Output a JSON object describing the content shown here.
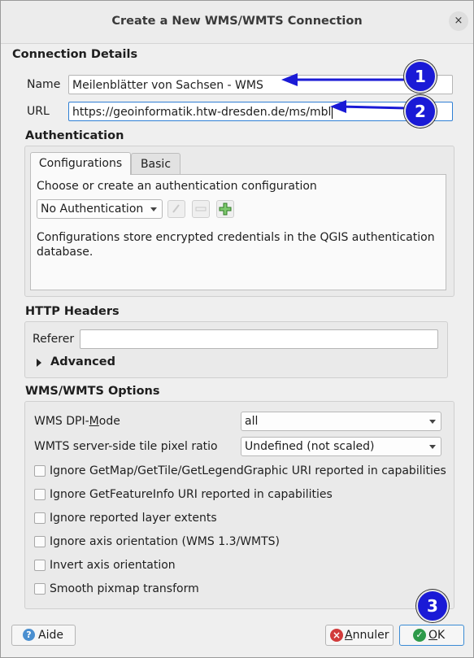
{
  "window": {
    "title": "Create a New WMS/WMTS Connection",
    "close_glyph": "×"
  },
  "connection": {
    "section_title": "Connection Details",
    "name_label": "Name",
    "name_value": "Meilenblätter von Sachsen - WMS",
    "url_label": "URL",
    "url_value": "https://geoinformatik.htw-dresden.de/ms/mbl"
  },
  "auth": {
    "section_title": "Authentication",
    "tabs": [
      {
        "label": "Configurations",
        "active": true
      },
      {
        "label": "Basic",
        "active": false
      }
    ],
    "prompt": "Choose or create an authentication configuration",
    "selected": "No Authentication",
    "info": "Configurations store encrypted credentials in the QGIS authentication database."
  },
  "http": {
    "section_title": "HTTP Headers",
    "referer_label": "Referer",
    "referer_value": "",
    "advanced_label": "Advanced"
  },
  "options": {
    "section_title": "WMS/WMTS Options",
    "dpi_label_pre": "WMS DPI-",
    "dpi_label_mnemonic": "M",
    "dpi_label_post": "ode",
    "dpi_value": "all",
    "tile_ratio_label": "WMTS server-side tile pixel ratio",
    "tile_ratio_value": "Undefined (not scaled)",
    "checkboxes": [
      {
        "label": "Ignore GetMap/GetTile/GetLegendGraphic URI reported in capabilities",
        "checked": false
      },
      {
        "label": "Ignore GetFeatureInfo URI reported in capabilities",
        "checked": false
      },
      {
        "label": "Ignore reported layer extents",
        "checked": false
      },
      {
        "label": "Ignore axis orientation (WMS 1.3/WMTS)",
        "checked": false
      },
      {
        "label": "Invert axis orientation",
        "checked": false
      },
      {
        "label": "Smooth pixmap transform",
        "checked": false
      }
    ]
  },
  "buttons": {
    "help_label": "Aide",
    "cancel_mnemonic": "A",
    "cancel_rest": "nnuler",
    "ok_mnemonic": "O",
    "ok_rest": "K"
  },
  "annotations": {
    "badge_1": "1",
    "badge_2": "2",
    "badge_3": "3",
    "color": "#1a1ad6"
  }
}
